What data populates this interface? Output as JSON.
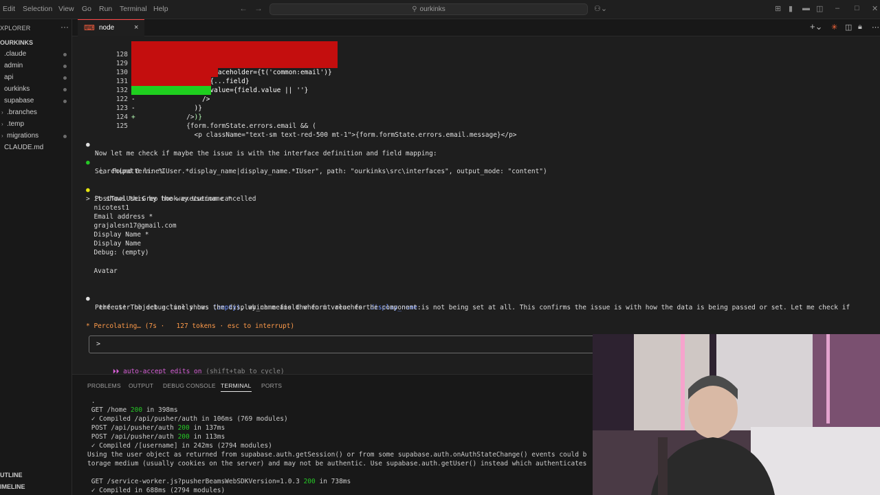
{
  "menu": [
    "Edit",
    "Selection",
    "View",
    "Go",
    "Run",
    "Terminal",
    "Help"
  ],
  "command_center": {
    "search_text": "ourkinks"
  },
  "sidebar": {
    "title": "XPLORER",
    "root": "OURKINKS",
    "items": [
      {
        "label": ".claude",
        "folder": false
      },
      {
        "label": "admin",
        "folder": false
      },
      {
        "label": "api",
        "folder": false
      },
      {
        "label": "ourkinks",
        "folder": false
      },
      {
        "label": "supabase",
        "folder": false
      },
      {
        "label": ".branches",
        "folder": true
      },
      {
        "label": ".temp",
        "folder": true
      },
      {
        "label": "migrations",
        "folder": true
      },
      {
        "label": "CLAUDE.md",
        "folder": false
      }
    ],
    "outline": "UTLINE",
    "timeline": "IMELINE"
  },
  "tab": {
    "label": "node",
    "close": "×"
  },
  "diff": {
    "removed": [
      {
        "no": "128",
        "code": "-                   placeholder={t('common:email')}"
      },
      {
        "no": "129",
        "code": "-                   {...field}"
      },
      {
        "no": "130",
        "code": "-                   value={field.value || ''}"
      },
      {
        "no": "131",
        "code": "-                 />"
      },
      {
        "no": "132",
        "code": "-               )}"
      }
    ],
    "added": {
      "no": "122",
      "code": "+               )}"
    },
    "context": [
      {
        "no": "123",
        "code": "              />"
      },
      {
        "no": "124",
        "code": "              {form.formState.errors.email && ("
      },
      {
        "no": "125",
        "code": "                <p className=\"text-sm text-red-500 mt-1\">{form.formState.errors.email.message}</p>"
      }
    ]
  },
  "transcript": {
    "check_msg": "Now let me check if maybe the issue is with the interface definition and field mapping:",
    "search_call": "Search(pattern: \"IUser.*display_name|display_name.*IUser\", path: \"ourkinks\\src\\interfaces\", output_mode: \"content\")",
    "search_result": "⎿  Found 0 lines",
    "hook_msg": "PostToolUse:Grep hook execution cancelled",
    "user_lines": [
      "> it shows this by the way Username *",
      "  nicotest1",
      "  Email address *",
      "  grajalesn17@gmail.com",
      "  Display Name *",
      "  Display Name",
      "  Debug: (empty)",
      "",
      "  Avatar"
    ],
    "perfect_msg": {
      "pre": "Perfect! The debug line shows ",
      "empty": "(empty)",
      "mid": ", which means the form value for ",
      "field": "display_name",
      "post": " is not being set at all. This confirms the issue is with how the data is being passed or set. Let me check if",
      "line2": " the user object actually has the display_name field when it reaches the component:"
    },
    "status": "* Percolating… (7s ·   127 tokens · esc to interrupt)",
    "prompt_symbol": ">",
    "auto_accept": "⏵⏵ auto-accept edits on",
    "auto_accept_hint": " (shift+tab to cycle)"
  },
  "panel_tabs": [
    "PROBLEMS",
    "OUTPUT",
    "DEBUG CONSOLE",
    "TERMINAL",
    "PORTS"
  ],
  "terminal": [
    {
      "pre": " .",
      "code": "",
      "post": ""
    },
    {
      "pre": " GET /home ",
      "code": "200",
      "post": " in 398ms"
    },
    {
      "pre": " ✓ Compiled /api/pusher/auth in 106ms (769 modules)",
      "code": "",
      "post": ""
    },
    {
      "pre": " POST /api/pusher/auth ",
      "code": "200",
      "post": " in 137ms"
    },
    {
      "pre": " POST /api/pusher/auth ",
      "code": "200",
      "post": " in 113ms"
    },
    {
      "pre": " ✓ Compiled /[username] in 242ms (2794 modules)",
      "code": "",
      "post": ""
    },
    {
      "pre": "Using the user object as returned from supabase.auth.getSession() or from some supabase.auth.onAuthStateChange() events could b",
      "code": "",
      "post": ""
    },
    {
      "pre": "torage medium (usually cookies on the server) and may not be authentic. Use supabase.auth.getUser() instead which authenticates",
      "code": "",
      "post": ""
    },
    {
      "pre": " GET /service-worker.js?pusherBeamsWebSDKVersion=1.0.3 ",
      "code": "200",
      "post": " in 738ms"
    },
    {
      "pre": " ✓ Compiled in 688ms (2794 modules)",
      "code": "",
      "post": ""
    }
  ]
}
